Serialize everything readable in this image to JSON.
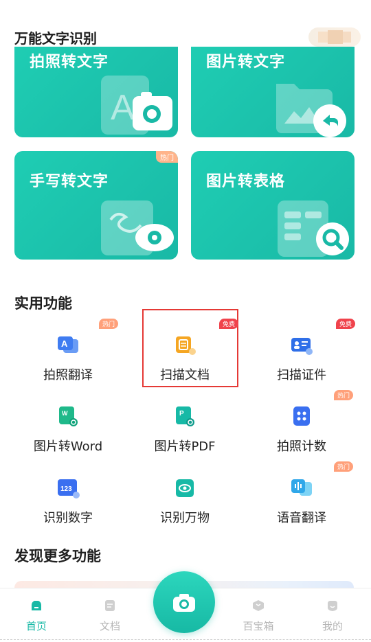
{
  "header": {
    "title": "万能文字识别"
  },
  "cards": [
    {
      "title": "拍照转文字",
      "badge": ""
    },
    {
      "title": "图片转文字",
      "badge": ""
    },
    {
      "title": "手写转文字",
      "badge": "热门"
    },
    {
      "title": "图片转表格",
      "badge": ""
    }
  ],
  "practical": {
    "title": "实用功能",
    "items": [
      {
        "label": "拍照翻译",
        "badge": "热门",
        "icon": "photo-translate-icon"
      },
      {
        "label": "扫描文档",
        "badge": "免费",
        "icon": "scan-document-icon"
      },
      {
        "label": "扫描证件",
        "badge": "免费",
        "icon": "scan-id-icon"
      },
      {
        "label": "图片转Word",
        "badge": "",
        "icon": "image-to-word-icon"
      },
      {
        "label": "图片转PDF",
        "badge": "",
        "icon": "image-to-pdf-icon"
      },
      {
        "label": "拍照计数",
        "badge": "热门",
        "icon": "photo-count-icon"
      },
      {
        "label": "识别数字",
        "badge": "",
        "icon": "recognize-digits-icon"
      },
      {
        "label": "识别万物",
        "badge": "",
        "icon": "recognize-objects-icon"
      },
      {
        "label": "语音翻译",
        "badge": "热门",
        "icon": "voice-translate-icon"
      }
    ]
  },
  "discover": {
    "title": "发现更多功能"
  },
  "tabbar": {
    "home": "首页",
    "docs": "文档",
    "toolbox": "百宝箱",
    "mine": "我的"
  },
  "colors": {
    "accent": "#19b9a6",
    "hot": "#ffa07a",
    "free": "#f0434c"
  }
}
